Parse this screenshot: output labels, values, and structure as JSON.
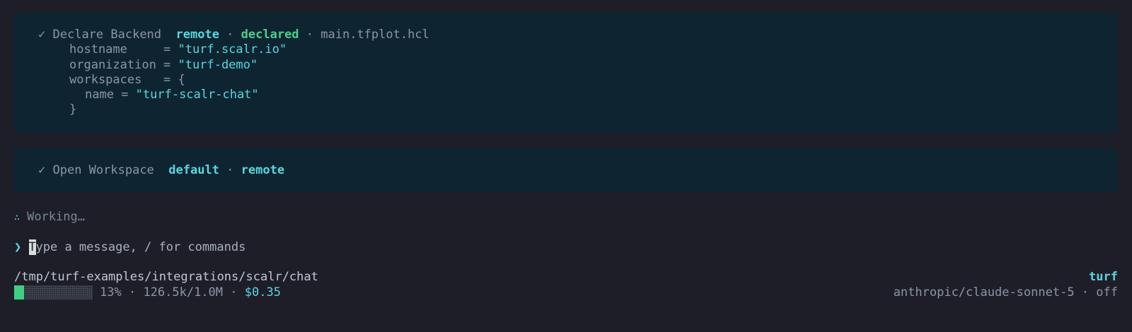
{
  "blocks": [
    {
      "check": "✓",
      "title": "Declare Backend",
      "tag1": "remote",
      "sep1": " · ",
      "tag2": "declared",
      "sep2": " · ",
      "file": "main.tfplot.hcl",
      "code": {
        "hostname_key": "hostname     = ",
        "hostname_val": "\"turf.scalr.io\"",
        "org_key": "organization = ",
        "org_val": "\"turf-demo\"",
        "ws_key": "workspaces   = {",
        "name_key": "name = ",
        "name_val": "\"turf-scalr-chat\"",
        "close": "}"
      }
    },
    {
      "check": "✓",
      "title": "Open Workspace",
      "tag1": "default",
      "sep1": " · ",
      "tag2": "remote"
    }
  ],
  "status": {
    "spinner": "∴",
    "text": "Working…"
  },
  "prompt": {
    "chevron": "❯",
    "cursor_char": "T",
    "placeholder_rest": "ype a message, / for commands"
  },
  "footer": {
    "path": "/tmp/turf-examples/integrations/scalr/chat",
    "app": "turf",
    "context_percent": "13%",
    "context_fraction": 0.13,
    "sep": " · ",
    "tokens": "126.5k/1.0M",
    "cost": "$0.35",
    "model": "anthropic/claude-sonnet-5",
    "mode": "off"
  },
  "colors": {
    "background": "#1e1e29",
    "block_bg": "#0e2431",
    "accent_cyan": "#5ad6dc",
    "accent_green": "#4cd08a",
    "bar_fill": "#3fcf83"
  }
}
